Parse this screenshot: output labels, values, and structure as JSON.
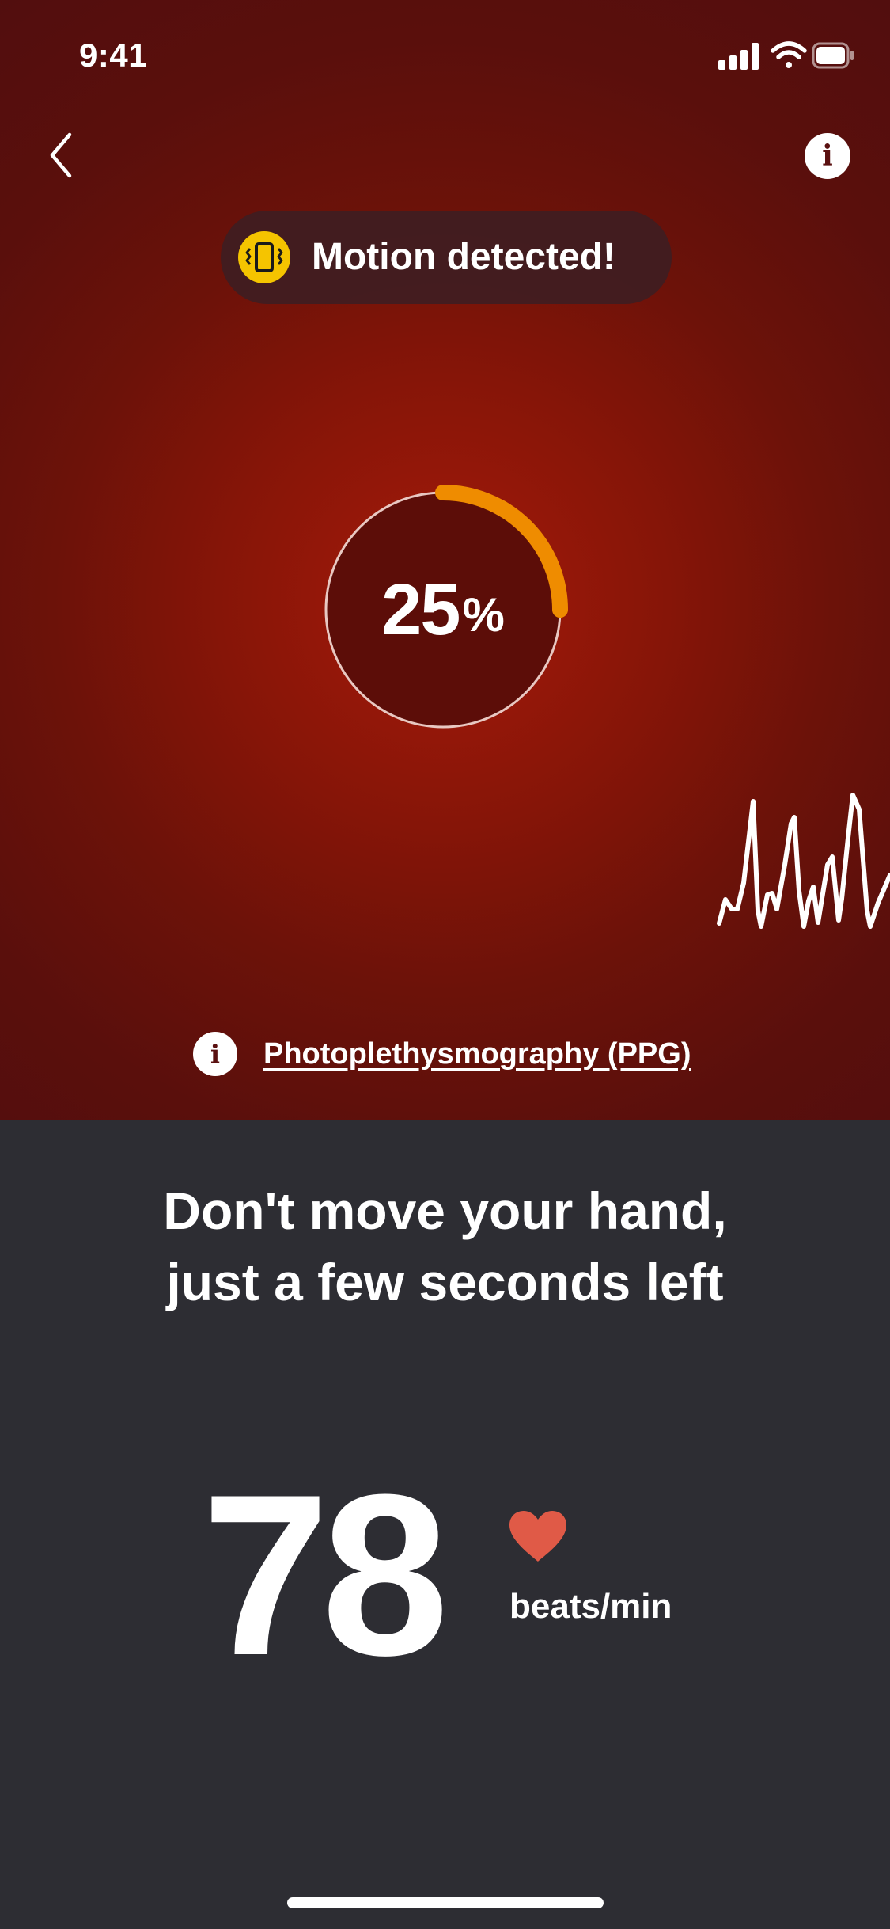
{
  "status_bar": {
    "time": "9:41",
    "icons": [
      "signal-icon",
      "wifi-icon",
      "battery-icon"
    ]
  },
  "header": {
    "back_icon": "chevron-left-icon",
    "info_icon": "info-icon",
    "info_glyph": "i"
  },
  "alert": {
    "icon": "phone-vibrate-icon",
    "text": "Motion detected!"
  },
  "progress": {
    "value": "25",
    "unit": "%",
    "fraction": 0.25
  },
  "ppg": {
    "info_glyph": "i",
    "link_text": "Photoplethysmography (PPG)"
  },
  "instruction": {
    "line1": "Don't move your hand,",
    "line2": "just a few seconds left"
  },
  "reading": {
    "value": "78",
    "unit": "beats/min",
    "icon": "heart-icon"
  },
  "colors": {
    "background_top": "#8a1a0c",
    "background_bottom": "#2d2d33",
    "progress_arc": "#ef8c00",
    "alert_icon": "#f5c400",
    "heart": "#e05a47"
  }
}
